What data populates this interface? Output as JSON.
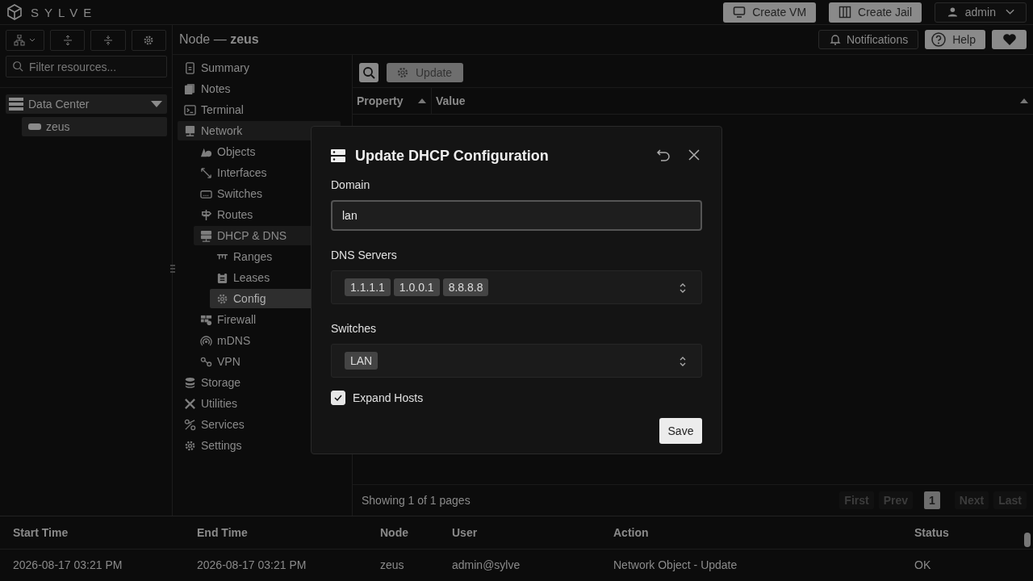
{
  "brand": "SYLVE",
  "top_buttons": [
    {
      "label": "Create VM"
    },
    {
      "label": "Create Jail"
    }
  ],
  "user_menu": {
    "label": "admin"
  },
  "resource_filter": {
    "placeholder": "Filter resources..."
  },
  "resource_tree": [
    {
      "label": "Data Center",
      "expanded": true,
      "children": [
        {
          "label": "zeus",
          "selected": true
        }
      ]
    }
  ],
  "page_title": {
    "prefix": "Node —",
    "name": "zeus"
  },
  "header_buttons": [
    {
      "label": "Notifications"
    },
    {
      "label": "Help"
    }
  ],
  "nav": [
    {
      "label": "Summary",
      "selected": false
    },
    {
      "label": "Notes",
      "selected": false
    },
    {
      "label": "Terminal",
      "selected": false
    },
    {
      "label": "Network",
      "selected": false,
      "expanded": true,
      "children": [
        {
          "label": "Objects",
          "selected": false
        },
        {
          "label": "Interfaces",
          "selected": false
        },
        {
          "label": "Switches",
          "selected": false
        },
        {
          "label": "Routes",
          "selected": false
        },
        {
          "label": "DHCP & DNS",
          "selected": false,
          "expanded": true,
          "children": [
            {
              "label": "Ranges",
              "selected": false
            },
            {
              "label": "Leases",
              "selected": false
            },
            {
              "label": "Config",
              "selected": true
            }
          ]
        },
        {
          "label": "Firewall",
          "selected": false
        },
        {
          "label": "mDNS",
          "selected": false
        },
        {
          "label": "VPN",
          "selected": false
        }
      ]
    },
    {
      "label": "Storage",
      "selected": false
    },
    {
      "label": "Utilities",
      "selected": false
    },
    {
      "label": "Services",
      "selected": false
    },
    {
      "label": "Settings",
      "selected": false
    }
  ],
  "toolbar": {
    "button": "Update"
  },
  "table": {
    "columns": [
      "Property",
      "Value"
    ]
  },
  "pagination": {
    "summary": "Showing 1 of 1 pages",
    "buttons": [
      {
        "label": "First",
        "selected": false
      },
      {
        "label": "Prev",
        "selected": false
      },
      {
        "label": "1",
        "selected": true
      },
      {
        "label": "Next",
        "selected": false
      },
      {
        "label": "Last",
        "selected": false
      }
    ]
  },
  "dialog": {
    "title": "Update DHCP Configuration",
    "domain": {
      "label": "Domain",
      "value": "lan"
    },
    "dns_servers": {
      "label": "DNS Servers",
      "tags": [
        "1.1.1.1",
        "1.0.0.1",
        "8.8.8.8"
      ]
    },
    "switches": {
      "label": "Switches",
      "tags": [
        "LAN"
      ]
    },
    "expand_hosts": {
      "label": "Expand Hosts",
      "checked": true
    },
    "save": "Save"
  },
  "log_table": {
    "columns": [
      "Start Time",
      "End Time",
      "Node",
      "User",
      "Action",
      "Status"
    ],
    "rows": [
      [
        "2026-08-17 03:21 PM",
        "2026-08-17 03:21 PM",
        "zeus",
        "admin@sylve",
        "Network Object - Update",
        "OK"
      ]
    ]
  }
}
